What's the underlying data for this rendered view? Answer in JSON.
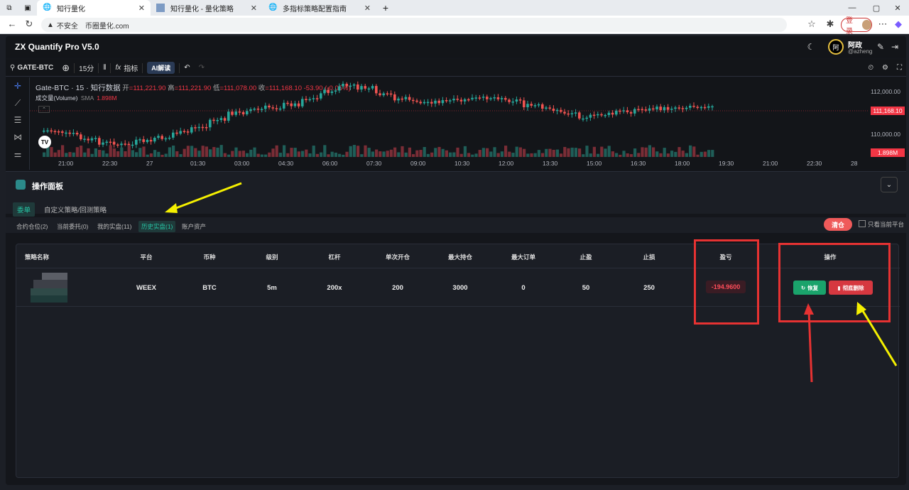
{
  "browser": {
    "tabs": [
      {
        "label": "知行量化",
        "active": true
      },
      {
        "label": "知行量化 - 量化策略",
        "active": false
      },
      {
        "label": "多指标策略配置指南",
        "active": false
      }
    ],
    "new_tab": "+",
    "security_label": "不安全",
    "url": "币圈量化.com",
    "login_label": "登录"
  },
  "app": {
    "title": "ZX Quantify Pro V5.0",
    "user_avatar_text": "阿",
    "user_name": "阿政",
    "user_handle": "@azheng"
  },
  "toolbar": {
    "symbol": "GATE-BTC",
    "interval": "15分",
    "indicators": "指标",
    "ai_label": "AI解读"
  },
  "chart": {
    "title": "Gate-BTC · 15 · 知行数据",
    "open_label": "开",
    "open": "=111,221.90",
    "high_label": "高",
    "high": "=111,221.90",
    "low_label": "低",
    "low": "=111,078.00",
    "close_label": "收",
    "close": "=111,168.10",
    "change": "-53.90 (-0.05%)",
    "volume_label": "成交量(Volume)",
    "sma_label": "SMA",
    "volume_value": "1.898M",
    "price_labels": [
      "112,000.00",
      "110,000.00"
    ],
    "current_price": "111,168.10",
    "current_volume": "1.898M",
    "time_labels": [
      "21:00",
      "22:30",
      "27",
      "01:30",
      "03:00",
      "04:30",
      "06:00",
      "07:30",
      "09:00",
      "10:30",
      "12:00",
      "13:30",
      "15:00",
      "16:30",
      "18:00",
      "19:30",
      "21:00",
      "22:30",
      "28"
    ],
    "up_color": "#26a69a",
    "down_color": "#ef5350"
  },
  "panel": {
    "title": "操作面板",
    "main_tabs": [
      "委单",
      "自定义策略/回测策略"
    ],
    "sub_tabs": [
      "合约仓位(2)",
      "当前委托(0)",
      "我的实盘(11)",
      "历史实盘(1)",
      "账户资产"
    ],
    "clear_label": "清仓",
    "only_current_label": "只看当前平台"
  },
  "table": {
    "headers": [
      "策略名称",
      "平台",
      "币种",
      "级别",
      "杠杆",
      "单次开仓",
      "最大持仓",
      "最大订单",
      "止盈",
      "止损",
      "盈亏",
      "操作"
    ],
    "rows": [
      {
        "platform": "WEEX",
        "coin": "BTC",
        "level": "5m",
        "leverage": "200x",
        "single_open": "200",
        "max_position": "3000",
        "max_orders": "0",
        "take_profit": "50",
        "stop_loss": "250",
        "pnl": "-194.9600",
        "restore_label": "恢复",
        "delete_label": "彻底删除"
      }
    ]
  },
  "colors": {
    "accent_teal": "#26c6a6",
    "pnl_red": "#ff4d5a",
    "annotation_red": "#e63232",
    "annotation_yellow": "#f5f000"
  }
}
